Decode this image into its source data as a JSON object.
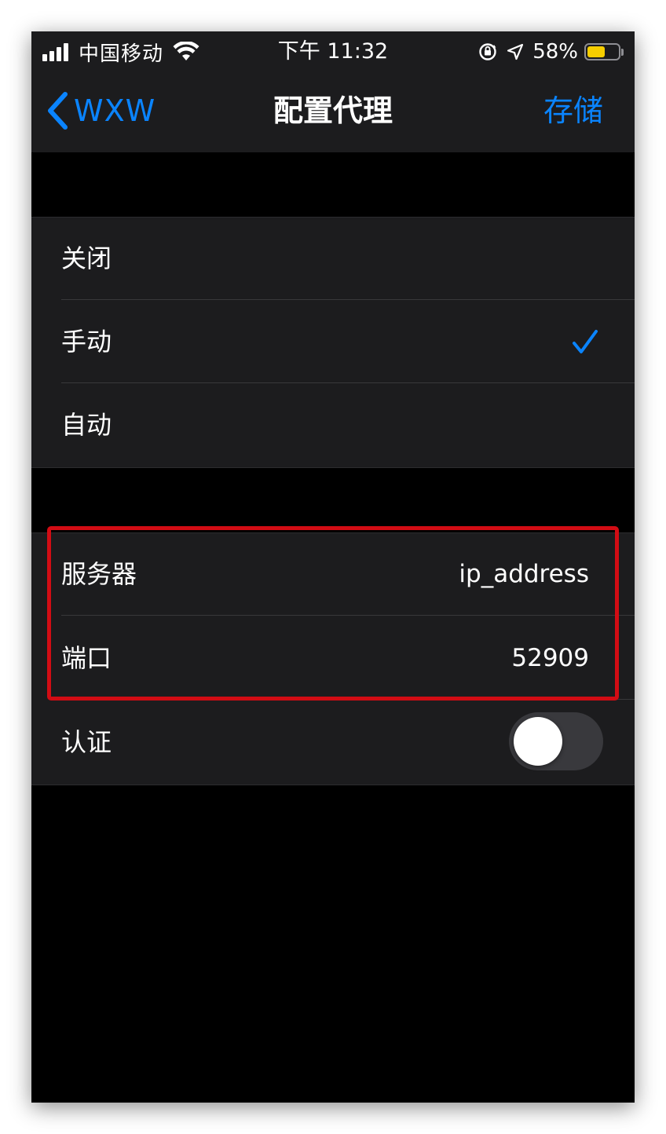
{
  "status_bar": {
    "carrier": "中国移动",
    "time": "下午 11:32",
    "battery_percent": "58%",
    "battery_level": 0.58,
    "icons": [
      "signal-icon",
      "wifi-icon",
      "orientation-lock-icon",
      "location-icon",
      "battery-icon"
    ]
  },
  "nav": {
    "back_label": "WXW",
    "title": "配置代理",
    "save_label": "存储"
  },
  "proxy_modes": [
    {
      "label": "关闭",
      "selected": false
    },
    {
      "label": "手动",
      "selected": true
    },
    {
      "label": "自动",
      "selected": false
    }
  ],
  "manual_settings": {
    "server_label": "服务器",
    "server_value": "ip_address",
    "port_label": "端口",
    "port_value": "52909",
    "auth_label": "认证",
    "auth_enabled": false
  },
  "colors": {
    "accent": "#0a84ff",
    "highlight": "#d20c14",
    "battery": "#f7ce00"
  }
}
